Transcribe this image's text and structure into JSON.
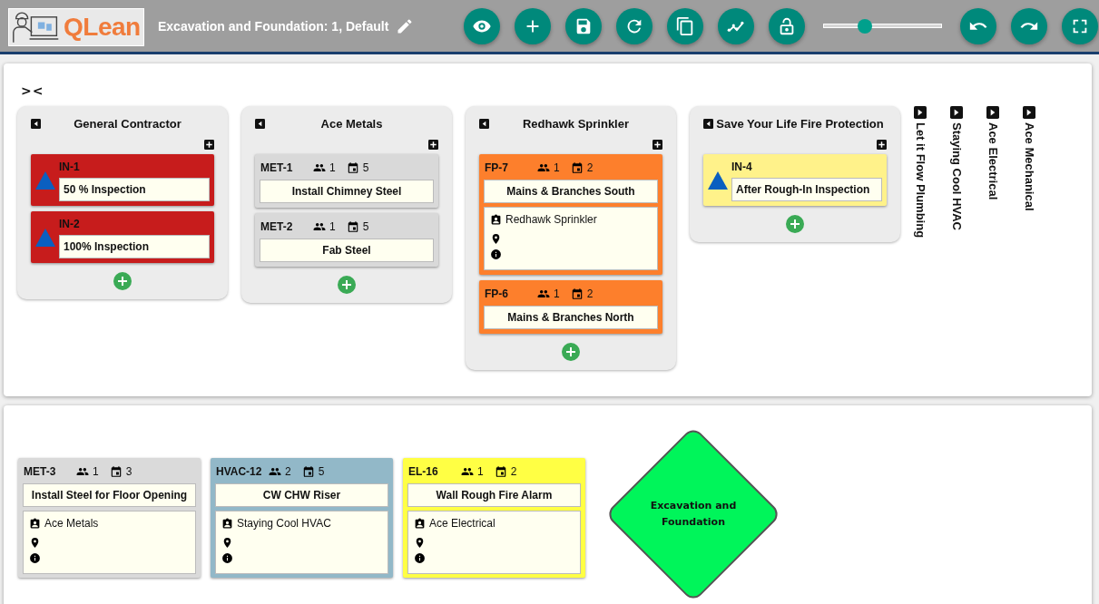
{
  "header": {
    "logo_text": "QLean",
    "title": "Excavation and Foundation: 1, Default",
    "zoom_slider": {
      "level": 0.35
    }
  },
  "board": {
    "toggle": "><",
    "lanes": [
      {
        "name": "General Contractor",
        "expanded": true,
        "cards": [
          {
            "kind": "inspection",
            "id": "IN-1",
            "title": "50 % Inspection",
            "color": "#c71c1c"
          },
          {
            "kind": "inspection",
            "id": "IN-2",
            "title": "100% Inspection",
            "color": "#c71c1c"
          }
        ]
      },
      {
        "name": "Ace Metals",
        "expanded": true,
        "cards": [
          {
            "kind": "task",
            "id": "MET-1",
            "crew": "1",
            "days": "5",
            "title": "Install Chimney Steel",
            "color": "#d9d9d9"
          },
          {
            "kind": "task",
            "id": "MET-2",
            "crew": "1",
            "days": "5",
            "title": "Fab Steel",
            "color": "#d9d9d9"
          }
        ]
      },
      {
        "name": "Redhawk Sprinkler",
        "expanded": true,
        "cards": [
          {
            "kind": "task",
            "id": "FP-7",
            "crew": "1",
            "days": "2",
            "title": "Mains & Branches South",
            "color": "#fd7f2c",
            "details": {
              "company": "Redhawk Sprinkler"
            }
          },
          {
            "kind": "task",
            "id": "FP-6",
            "crew": "1",
            "days": "2",
            "title": "Mains & Branches North",
            "color": "#fd7f2c"
          }
        ]
      },
      {
        "name": "Save Your Life Fire Protection",
        "expanded": true,
        "cards": [
          {
            "kind": "inspection",
            "id": "IN-4",
            "title": "After Rough-In Inspection",
            "color": "#fff28a"
          }
        ]
      },
      {
        "name": "Let it Flow Plumbing",
        "expanded": false
      },
      {
        "name": "Staying Cool HVAC",
        "expanded": false
      },
      {
        "name": "Ace Electrical",
        "expanded": false
      },
      {
        "name": "Ace Mechanical",
        "expanded": false
      }
    ]
  },
  "backlog": {
    "cards": [
      {
        "kind": "task",
        "id": "MET-3",
        "crew": "1",
        "days": "3",
        "title": "Install Steel for Floor Opening",
        "color": "#dadada",
        "details": {
          "company": "Ace Metals"
        }
      },
      {
        "kind": "task",
        "id": "HVAC-12",
        "crew": "2",
        "days": "5",
        "title": "CW CHW Riser",
        "color": "#92b8c8",
        "details": {
          "company": "Staying Cool HVAC"
        }
      },
      {
        "kind": "task",
        "id": "EL-16",
        "crew": "1",
        "days": "2",
        "title": "Wall Rough Fire Alarm",
        "color": "#ffff44",
        "details": {
          "company": "Ace Electrical"
        }
      }
    ],
    "milestone": {
      "label": "Excavation and Foundation",
      "color": "#00f55a"
    }
  }
}
